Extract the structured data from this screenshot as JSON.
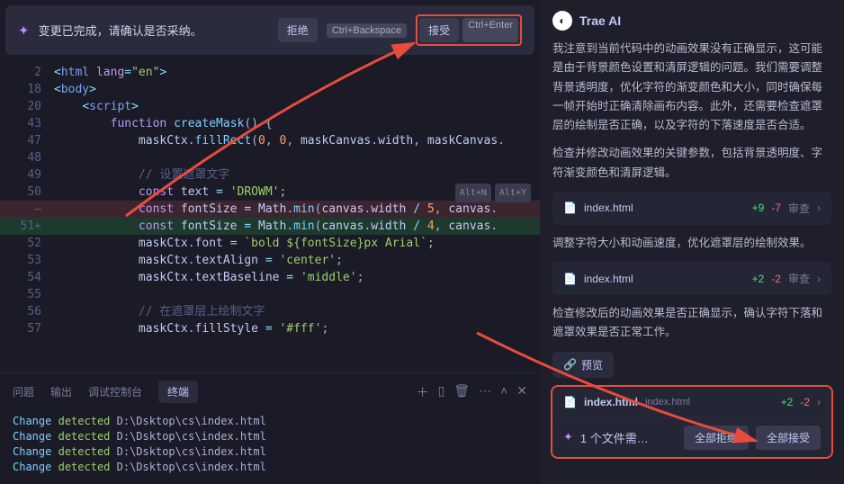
{
  "topbar": {
    "message": "变更已完成，请确认是否采纳。",
    "reject_label": "拒绝",
    "reject_kbd": "Ctrl+Backspace",
    "accept_label": "接受",
    "accept_kbd": "Ctrl+Enter"
  },
  "hints": {
    "altN": "Alt+N",
    "altY": "Alt+Y"
  },
  "code_lines": [
    {
      "n": "2",
      "cls": "",
      "html": "<span class='tk-op'>&lt;</span><span class='tk-tag'>html</span> <span class='tk-attr'>lang</span><span class='tk-op'>=</span><span class='tk-str'>\"en\"</span><span class='tk-op'>&gt;</span>"
    },
    {
      "n": "18",
      "cls": "",
      "html": "<span class='tk-op'>&lt;</span><span class='tk-tag'>body</span><span class='tk-op'>&gt;</span>"
    },
    {
      "n": "20",
      "cls": "",
      "html": "    <span class='tk-op'>&lt;</span><span class='tk-tag'>script</span><span class='tk-op'>&gt;</span>"
    },
    {
      "n": "43",
      "cls": "",
      "html": "        <span class='tk-kw'>function</span> <span class='tk-fn'>createMask</span>() {"
    },
    {
      "n": "",
      "cls": "",
      "html": ""
    },
    {
      "n": "47",
      "cls": "",
      "html": "            <span class='tk-var'>maskCtx</span>.<span class='tk-fn'>fillRect</span>(<span class='tk-num'>0</span>, <span class='tk-num'>0</span>, <span class='tk-var'>maskCanvas</span>.<span class='tk-var'>width</span>, <span class='tk-var'>maskCanvas</span>."
    },
    {
      "n": "48",
      "cls": "",
      "html": ""
    },
    {
      "n": "49",
      "cls": "",
      "html": "            <span class='tk-com'>// 设置遮罩文字</span>"
    },
    {
      "n": "50",
      "cls": "hint",
      "html": "            <span class='tk-kw'>const</span> <span class='tk-var'>text</span> <span class='tk-op'>=</span> <span class='tk-str'>'DROWM'</span>;"
    },
    {
      "n": "—",
      "cls": "line-del",
      "html": "            <span class='tk-kw'>const</span> <span class='tk-var'>fontSize</span> <span class='tk-op'>=</span> <span class='tk-var'>Math</span>.<span class='tk-fn'>min</span>(<span class='tk-var'>canvas</span>.<span class='tk-var'>width</span> <span class='tk-op'>/</span> <span class='tk-num'>5</span>, <span class='tk-var'>canvas</span>."
    },
    {
      "n": "51+",
      "cls": "line-add",
      "html": "            <span class='tk-kw'>const</span> <span class='tk-var'>fontSize</span> <span class='tk-op'>=</span> <span class='tk-var'>Math</span>.<span class='tk-fn'>min</span>(<span class='tk-var'>canvas</span>.<span class='tk-var'>width</span> <span class='tk-op'>/</span> <span class='tk-num'>4</span>, <span class='tk-var'>canvas</span>."
    },
    {
      "n": "52",
      "cls": "",
      "html": "            <span class='tk-var'>maskCtx</span>.<span class='tk-var'>font</span> <span class='tk-op'>=</span> <span class='tk-str'>`bold ${fontSize}px Arial`</span>;"
    },
    {
      "n": "53",
      "cls": "",
      "html": "            <span class='tk-var'>maskCtx</span>.<span class='tk-var'>textAlign</span> <span class='tk-op'>=</span> <span class='tk-str'>'center'</span>;"
    },
    {
      "n": "54",
      "cls": "",
      "html": "            <span class='tk-var'>maskCtx</span>.<span class='tk-var'>textBaseline</span> <span class='tk-op'>=</span> <span class='tk-str'>'middle'</span>;"
    },
    {
      "n": "55",
      "cls": "",
      "html": ""
    },
    {
      "n": "56",
      "cls": "",
      "html": "            <span class='tk-com'>// 在遮罩层上绘制文字</span>"
    },
    {
      "n": "57",
      "cls": "",
      "html": "            <span class='tk-var'>maskCtx</span>.<span class='tk-var'>fillStyle</span> <span class='tk-op'>=</span> <span class='tk-str'>'#fff'</span>;"
    }
  ],
  "tabs": {
    "problems": "问题",
    "output": "输出",
    "debug_console": "调试控制台",
    "terminal": "终端"
  },
  "terminal_lines": [
    {
      "change": "Change",
      "detected": "detected",
      "path": "D:\\Dsktop\\cs\\index.html"
    },
    {
      "change": "Change",
      "detected": "detected",
      "path": "D:\\Dsktop\\cs\\index.html"
    },
    {
      "change": "Change",
      "detected": "detected",
      "path": "D:\\Dsktop\\cs\\index.html"
    },
    {
      "change": "Change",
      "detected": "detected",
      "path": "D:\\Dsktop\\cs\\index.html"
    }
  ],
  "ai": {
    "title": "Trae AI",
    "para1": "我注意到当前代码中的动画效果没有正确显示，这可能是由于背景颜色设置和清屏逻辑的问题。我们需要调整背景透明度，优化字符的渐变颜色和大小，同时确保每一帧开始时正确清除画布内容。此外，还需要检查遮罩层的绘制是否正确，以及字符的下落速度是否合适。",
    "para2": "检查并修改动画效果的关键参数，包括背景透明度、字符渐变颜色和清屏逻辑。",
    "para3": "调整字符大小和动画速度，优化遮罩层的绘制效果。",
    "para4": "检查修改后的动画效果是否正确显示，确认字符下落和遮罩效果是否正常工作。",
    "file1": {
      "name": "index.html",
      "add": "+9",
      "del": "-7",
      "review": "审查"
    },
    "file2": {
      "name": "index.html",
      "add": "+2",
      "del": "-2",
      "review": "审查"
    },
    "preview": "预览",
    "action_file": {
      "name": "index.html",
      "sub": "index.html",
      "add": "+2",
      "del": "-2"
    },
    "change_count": "1 个文件需…",
    "reject_all": "全部拒绝",
    "accept_all": "全部接受"
  }
}
